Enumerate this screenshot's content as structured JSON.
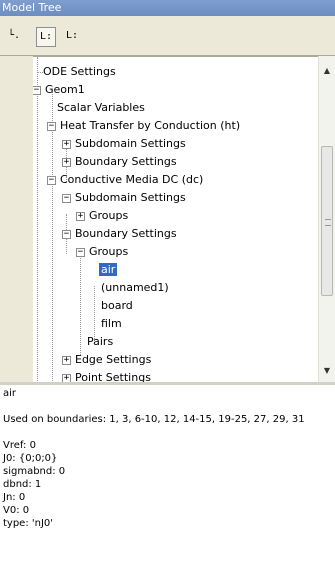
{
  "window": {
    "title": "Model Tree"
  },
  "toolbar": {
    "btn1": "└.",
    "btn2": "L:",
    "btn3": "L:"
  },
  "tree": {
    "items": [
      "ODE Settings",
      "Geom1",
      "Scalar Variables",
      "Heat Transfer by Conduction (ht)",
      "Subdomain Settings",
      "Boundary Settings",
      "Conductive Media DC (dc)",
      "Subdomain Settings",
      "Groups",
      "Boundary Settings",
      "Groups",
      "air",
      "(unnamed1)",
      "board",
      "film",
      "Pairs",
      "Edge Settings",
      "Point Settings"
    ]
  },
  "info": {
    "selected": "air",
    "used_on": "Used on boundaries: 1, 3, 6-10, 12, 14-15, 19-25, 27, 29, 31",
    "props": [
      "Vref: 0",
      "J0: {0;0;0}",
      "sigmabnd: 0",
      "dbnd: 1",
      "Jn: 0",
      "V0: 0",
      "type: 'nJ0'"
    ]
  }
}
